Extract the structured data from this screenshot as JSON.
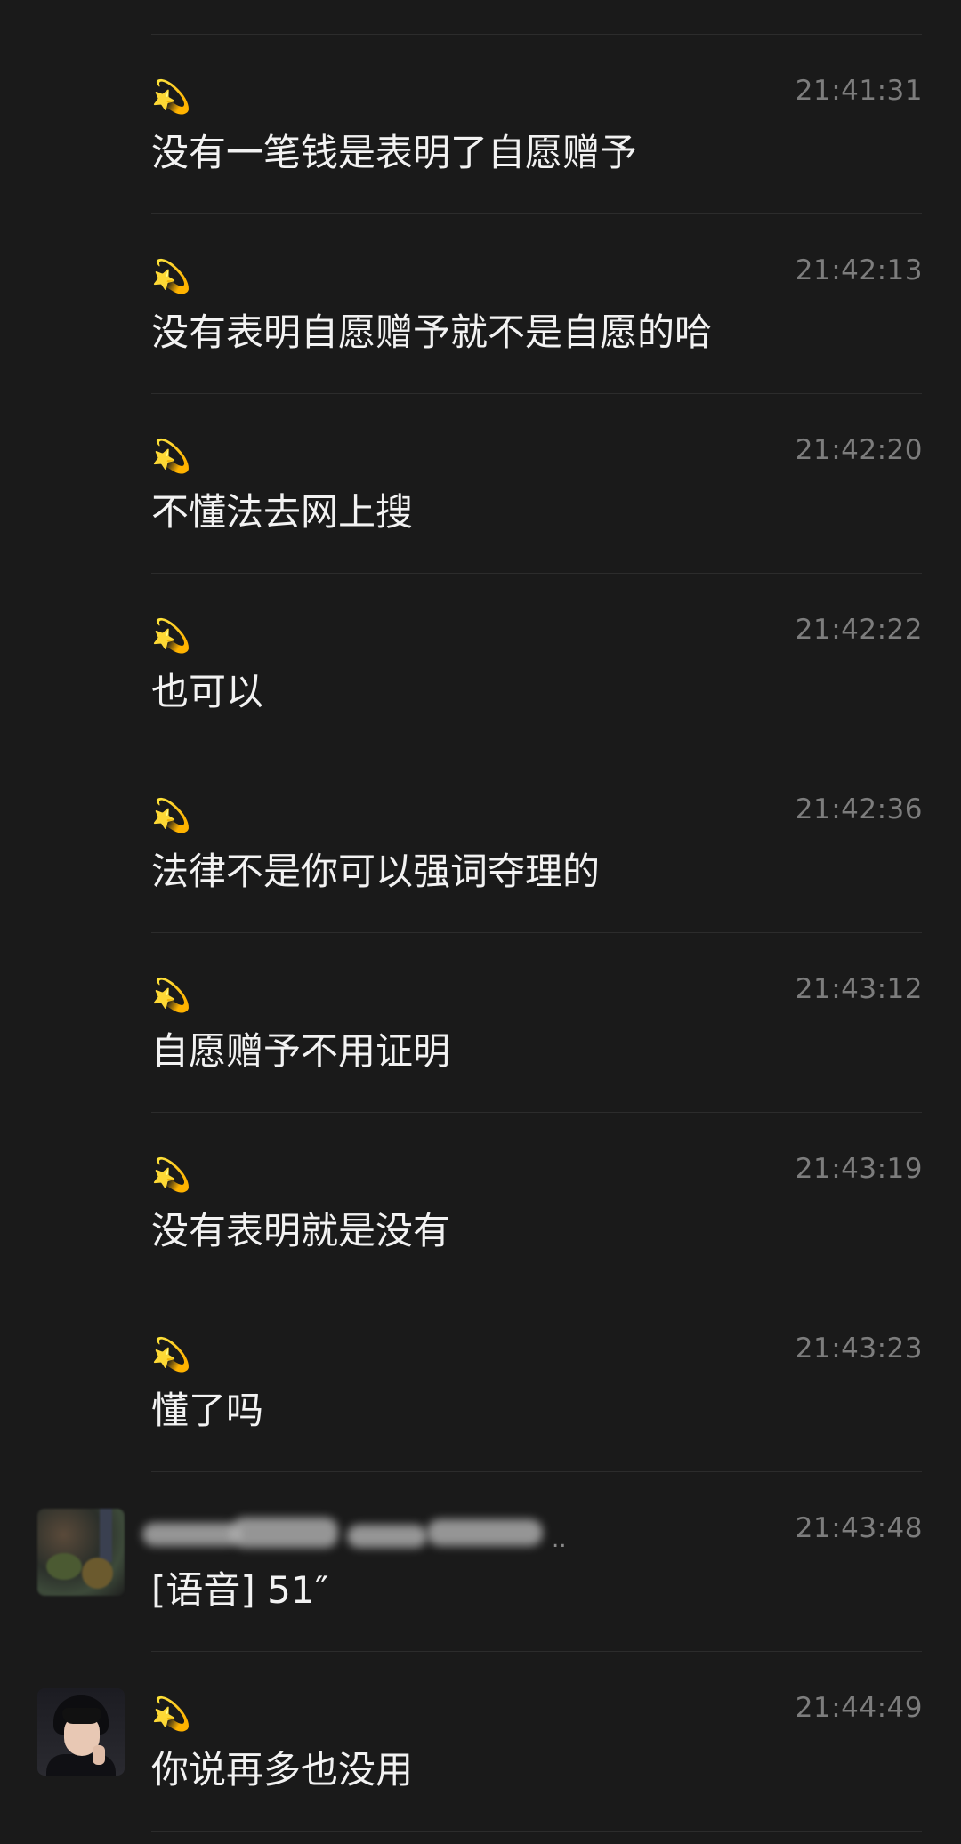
{
  "messages": [
    {
      "sender_icon": "💫",
      "time": "21:41:31",
      "text": "没有一笔钱是表明了自愿赠予"
    },
    {
      "sender_icon": "💫",
      "time": "21:42:13",
      "text": "没有表明自愿赠予就不是自愿的哈"
    },
    {
      "sender_icon": "💫",
      "time": "21:42:20",
      "text": "不懂法去网上搜"
    },
    {
      "sender_icon": "💫",
      "time": "21:42:22",
      "text": "也可以"
    },
    {
      "sender_icon": "💫",
      "time": "21:42:36",
      "text": "法律不是你可以强词夺理的"
    },
    {
      "sender_icon": "💫",
      "time": "21:43:12",
      "text": "自愿赠予不用证明"
    },
    {
      "sender_icon": "💫",
      "time": "21:43:19",
      "text": "没有表明就是没有"
    },
    {
      "sender_icon": "💫",
      "time": "21:43:23",
      "text": "懂了吗"
    },
    {
      "time": "21:43:48",
      "text": "[语音] 51″",
      "name_suffix": ".."
    },
    {
      "sender_icon": "💫",
      "time": "21:44:49",
      "text": "你说再多也没用"
    }
  ]
}
